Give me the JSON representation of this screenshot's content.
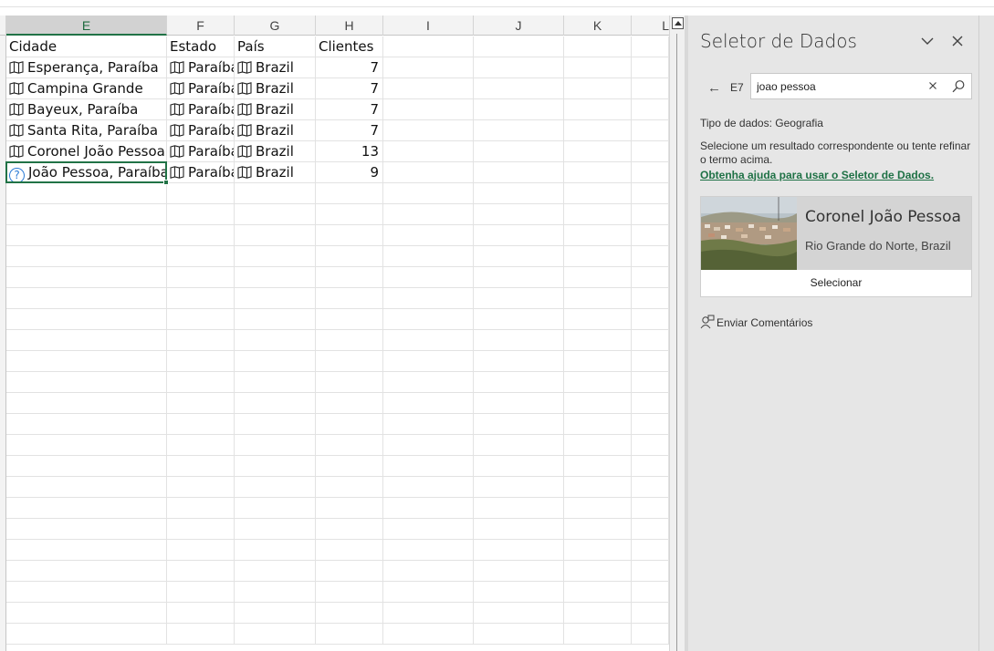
{
  "grid": {
    "columns": [
      "E",
      "F",
      "G",
      "H",
      "I",
      "J",
      "K",
      "L"
    ],
    "active_column": "E",
    "header_row": [
      "Cidade",
      "Estado",
      "País",
      "Clientes"
    ],
    "rows": [
      {
        "cidade": "Esperança, Paraíba",
        "estado": "Paraíba",
        "pais": "Brazil",
        "clientes": "7",
        "type": "map"
      },
      {
        "cidade": "Campina Grande",
        "estado": "Paraíba",
        "pais": "Brazil",
        "clientes": "7",
        "type": "map"
      },
      {
        "cidade": "Bayeux, Paraíba",
        "estado": "Paraíba",
        "pais": "Brazil",
        "clientes": "7",
        "type": "map"
      },
      {
        "cidade": "Santa Rita, Paraíba",
        "estado": "Paraíba",
        "pais": "Brazil",
        "clientes": "7",
        "type": "map"
      },
      {
        "cidade": "Coronel João Pessoa",
        "estado": "Paraíba",
        "pais": "Brazil",
        "clientes": "13",
        "type": "map"
      },
      {
        "cidade": "João Pessoa, Paraíba",
        "estado": "Paraíba",
        "pais": "Brazil",
        "clientes": "9",
        "type": "question"
      }
    ],
    "icons": {
      "map": "map-icon",
      "question": "question-icon"
    }
  },
  "pane": {
    "title": "Seletor de Dados",
    "back_icon": "back-arrow-icon",
    "cell_ref": "E7",
    "search_value": "joao pessoa",
    "data_type": "Tipo de dados: Geografia",
    "hint": "Selecione um resultado correspondente ou tente refinar o termo acima.",
    "help_link": "Obtenha ajuda para usar o Seletor de Dados.",
    "result": {
      "name": "Coronel João Pessoa",
      "subtitle": "Rio Grande do Norte, Brazil",
      "select_label": "Selecionar"
    },
    "feedback": "Enviar Comentários"
  },
  "colors": {
    "accent": "#217346",
    "link": "#1e7145",
    "pane_bg": "#e6e6e6"
  }
}
